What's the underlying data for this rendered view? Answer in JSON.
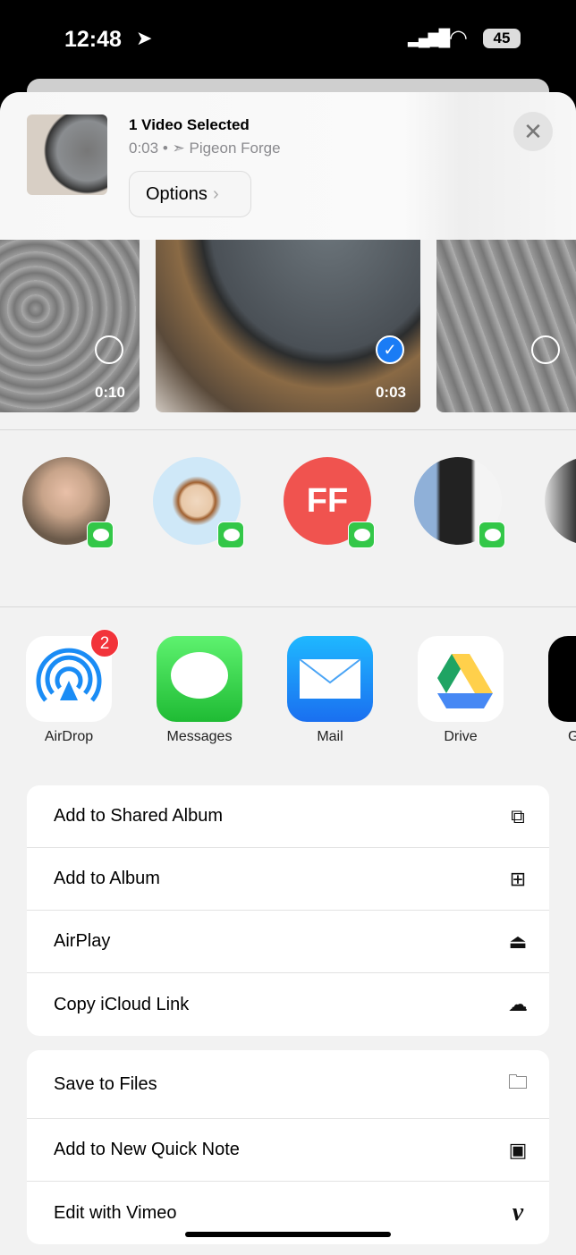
{
  "status": {
    "time": "12:48",
    "battery": "45"
  },
  "header": {
    "title": "1 Video Selected",
    "duration": "0:03",
    "location": "Pigeon Forge",
    "options_label": "Options",
    "close_icon": "close-icon"
  },
  "photos": [
    {
      "duration": "0:10",
      "selected": false
    },
    {
      "duration": "0:03",
      "selected": true
    },
    {
      "duration": "",
      "selected": false
    }
  ],
  "people": [
    {
      "type": "photo",
      "color": "#c8a48a"
    },
    {
      "type": "memoji",
      "color": "#cfe8f8"
    },
    {
      "type": "initials",
      "initials": "FF",
      "color": "#f0534f"
    },
    {
      "type": "photo",
      "color": "#6e7f8f"
    },
    {
      "type": "photo",
      "color": "#6a7560"
    }
  ],
  "apps": [
    {
      "label": "AirDrop",
      "badge": "2"
    },
    {
      "label": "Messages"
    },
    {
      "label": "Mail"
    },
    {
      "label": "Drive"
    },
    {
      "label": "G"
    }
  ],
  "actions1": [
    {
      "label": "Add to Shared Album",
      "icon": "shared-album-icon"
    },
    {
      "label": "Add to Album",
      "icon": "add-album-icon"
    },
    {
      "label": "AirPlay",
      "icon": "airplay-icon"
    },
    {
      "label": "Copy iCloud Link",
      "icon": "icloud-link-icon"
    }
  ],
  "actions2": [
    {
      "label": "Save to Files",
      "icon": "folder-icon"
    },
    {
      "label": "Add to New Quick Note",
      "icon": "quick-note-icon"
    },
    {
      "label": "Edit with Vimeo",
      "icon": "vimeo-icon"
    }
  ],
  "colors": {
    "accent": "#1a7cf5",
    "messages_green": "#33c748",
    "badge_red": "#f2333a"
  }
}
